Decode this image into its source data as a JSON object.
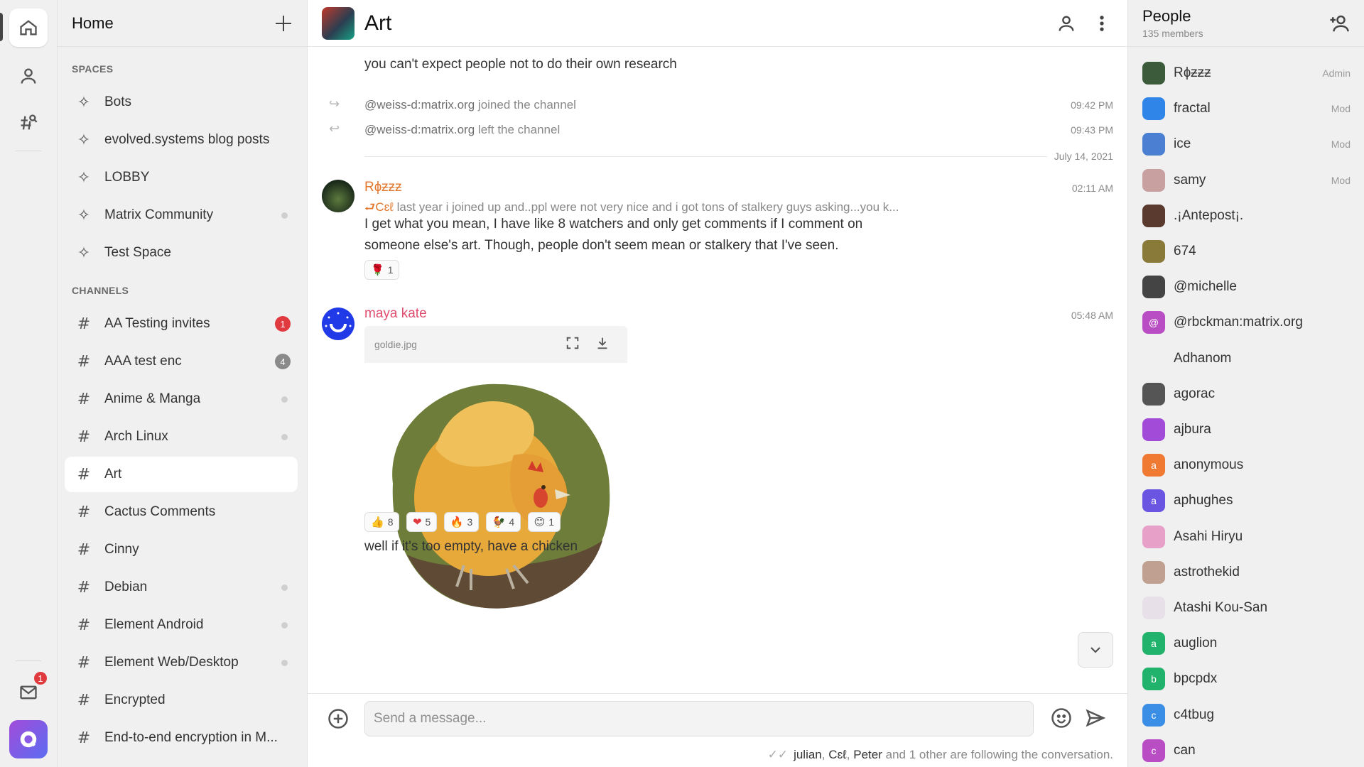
{
  "rail": {
    "badge_count": "1"
  },
  "roomlist": {
    "title": "Home",
    "spaces_label": "SPACES",
    "spaces": [
      {
        "name": "Bots",
        "dot": false
      },
      {
        "name": "evolved.systems blog posts",
        "dot": false
      },
      {
        "name": "LOBBY",
        "dot": false
      },
      {
        "name": "Matrix Community",
        "dot": true
      },
      {
        "name": "Test Space",
        "dot": false
      }
    ],
    "channels_label": "CHANNELS",
    "channels": [
      {
        "name": "AA Testing invites",
        "badge": "1",
        "badge_color": "#e0393e"
      },
      {
        "name": "AAA test enc",
        "badge": "4",
        "badge_color": "#8a8a8a"
      },
      {
        "name": "Anime & Manga",
        "dot": true
      },
      {
        "name": "Arch Linux",
        "dot": true
      },
      {
        "name": "Art",
        "selected": true
      },
      {
        "name": "Cactus Comments"
      },
      {
        "name": "Cinny"
      },
      {
        "name": "Debian",
        "dot": true
      },
      {
        "name": "Element Android",
        "dot": true
      },
      {
        "name": "Element Web/Desktop",
        "dot": true
      },
      {
        "name": "Encrypted"
      },
      {
        "name": "End-to-end encryption in M..."
      }
    ]
  },
  "room": {
    "title": "Art"
  },
  "timeline": {
    "prev_text": "you can't expect people not to do their own research",
    "events": [
      {
        "user": "@weiss-d:matrix.org",
        "action": "joined the channel",
        "time": "09:42 PM"
      },
      {
        "user": "@weiss-d:matrix.org",
        "action": "left the channel",
        "time": "09:43 PM"
      }
    ],
    "date_separator": "July 14, 2021",
    "message1": {
      "sender": "Rɸƶƶƶ",
      "sender_color": "#e2762c",
      "time": "02:11 AM",
      "reply_name": "Cɛℓ",
      "reply_text": "last year i joined up and..ppl were not very nice and i got tons of stalkery guys asking...you k...",
      "line1": "I get what you mean, I have like 8 watchers and only get comments if I comment on",
      "line2": "someone else's art. Though, people don't seem mean or stalkery that I've seen.",
      "reactions": [
        {
          "emoji": "🌹",
          "count": "1"
        }
      ]
    },
    "message2": {
      "sender": "maya kate",
      "sender_color": "#e04e6f",
      "time": "05:48 AM",
      "attachment_name": "goldie.jpg",
      "reactions": [
        {
          "emoji": "👍",
          "count": "8"
        },
        {
          "emoji": "❤",
          "count": "5"
        },
        {
          "emoji": "🔥",
          "count": "3"
        },
        {
          "emoji": "🐓",
          "count": "4"
        },
        {
          "emoji": "😊",
          "count": "1"
        }
      ],
      "text": "well if it's too empty, have a chicken"
    }
  },
  "composer": {
    "placeholder": "Send a message...",
    "following": {
      "names": [
        "julian",
        "Cɛℓ",
        "Peter"
      ],
      "rest": "and 1 other are following the conversation."
    }
  },
  "people": {
    "title": "People",
    "count": "135 members",
    "members": [
      {
        "name": "Rɸƶƶƶ",
        "role": "Admin",
        "color": "#3b5b3b"
      },
      {
        "name": "fractal",
        "role": "Mod",
        "color": "#2f86e8"
      },
      {
        "name": "ice",
        "role": "Mod",
        "color": "#4a7fd1"
      },
      {
        "name": "samy",
        "role": "Mod",
        "color": "#c9a0a0"
      },
      {
        "name": ".¡Antepost¡.",
        "role": "",
        "color": "#5a3a2e"
      },
      {
        "name": "674",
        "role": "",
        "color": "#8a7a3a"
      },
      {
        "name": "@michelle",
        "role": "",
        "color": "#444444"
      },
      {
        "name": "@rbckman:matrix.org",
        "role": "",
        "color": "#b94ec4",
        "letter": "@"
      },
      {
        "name": "Adhanom",
        "role": "",
        "color": "#f0f0f0"
      },
      {
        "name": "agorac",
        "role": "",
        "color": "#555555"
      },
      {
        "name": "ajbura",
        "role": "",
        "color": "#a24bd9"
      },
      {
        "name": "anonymous",
        "role": "",
        "color": "#f07a31",
        "letter": "a"
      },
      {
        "name": "aphughes",
        "role": "",
        "color": "#6a55e2",
        "letter": "a"
      },
      {
        "name": "Asahi Hiryu",
        "role": "",
        "color": "#e7a0c8"
      },
      {
        "name": "astrothekid",
        "role": "",
        "color": "#c0a090"
      },
      {
        "name": "Atashi Kou-San",
        "role": "",
        "color": "#e8e0e8"
      },
      {
        "name": "auglion",
        "role": "",
        "color": "#21b26b",
        "letter": "a"
      },
      {
        "name": "bpcpdx",
        "role": "",
        "color": "#21b26b",
        "letter": "b"
      },
      {
        "name": "c4tbug",
        "role": "",
        "color": "#3a8ee6",
        "letter": "c"
      },
      {
        "name": "can",
        "role": "",
        "color": "#b94ec4",
        "letter": "c"
      }
    ]
  }
}
